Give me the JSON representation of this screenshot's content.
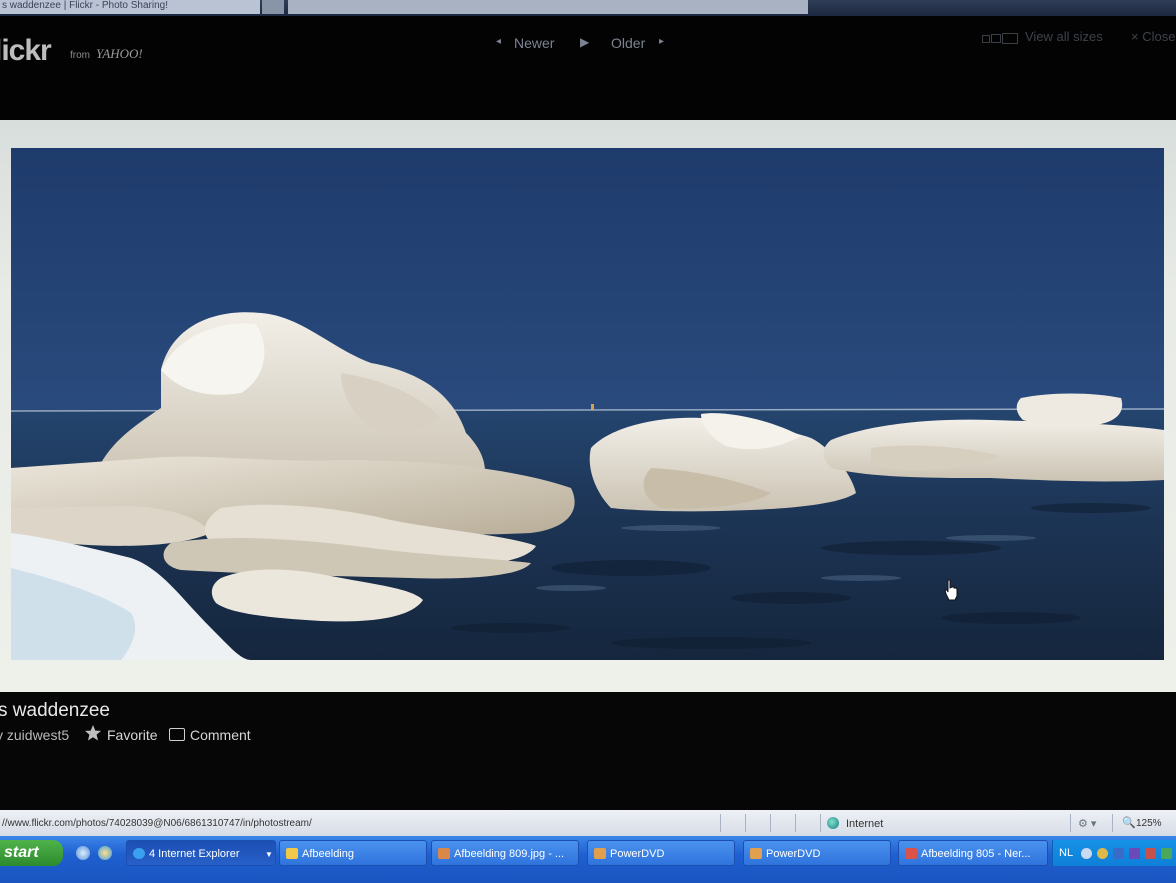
{
  "browser": {
    "window_title": "s waddenzee | Flickr - Photo Sharing!"
  },
  "header": {
    "logo": "lickr",
    "logo_from": "from",
    "logo_yahoo": "YAHOO!",
    "newer_label": "Newer",
    "older_label": "Older",
    "view_all_sizes_label": "View all sizes",
    "close_label": "× Close"
  },
  "photo": {
    "title": "s waddenzee",
    "owner": "y zuidwest5",
    "favorite_label": "Favorite",
    "comment_label": "Comment"
  },
  "statusbar": {
    "url": "//www.flickr.com/photos/74028039@N06/6861310747/in/photostream/",
    "zone": "Internet",
    "zoom": "125%"
  },
  "taskbar": {
    "start_label": "start",
    "tasks": [
      {
        "label": "4 Internet Explorer",
        "icon": "ie-icon",
        "color": "#3aa0f0"
      },
      {
        "label": "Afbeelding",
        "icon": "folder-icon",
        "color": "#f1c84a"
      },
      {
        "label": "Afbeelding 809.jpg - ...",
        "icon": "image-editor-icon",
        "color": "#d9884a"
      },
      {
        "label": "PowerDVD",
        "icon": "powerdvd-icon",
        "color": "#e1a050"
      },
      {
        "label": "PowerDVD",
        "icon": "powerdvd-icon",
        "color": "#e1a050"
      },
      {
        "label": "Afbeelding 805 - Ner...",
        "icon": "nero-icon",
        "color": "#d9534a"
      }
    ],
    "tray": {
      "language": "NL"
    }
  },
  "colors": {
    "sky": "#1f3e6f",
    "water": "#1a2f4d",
    "ice": "#e8e4dc",
    "taskbar": "#245edb"
  }
}
